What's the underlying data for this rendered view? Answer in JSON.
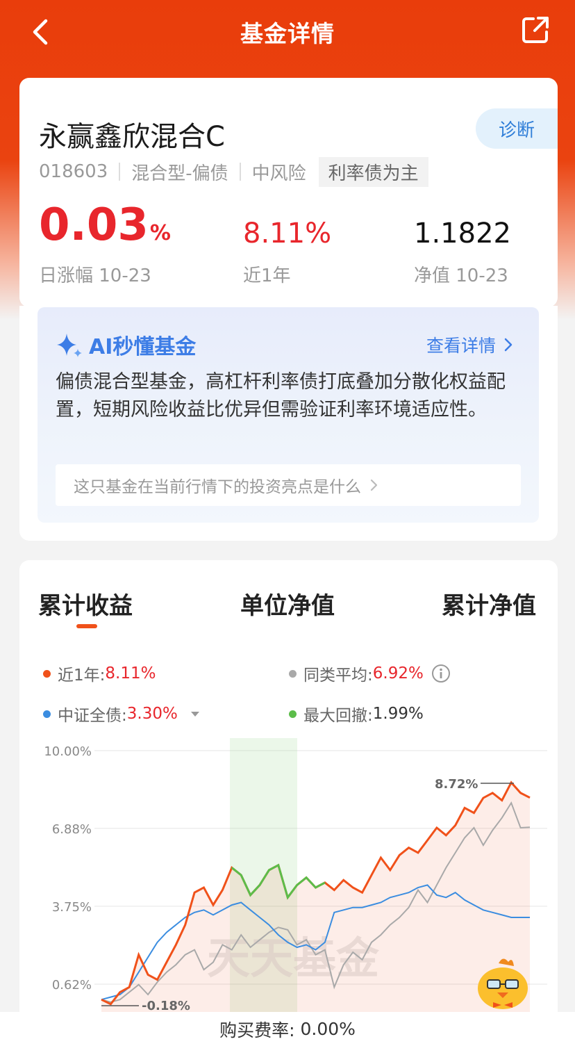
{
  "header": {
    "title": "基金详情"
  },
  "fund": {
    "name": "永赢鑫欣混合C",
    "diagnose_label": "诊断",
    "code": "018603",
    "type": "混合型-偏债",
    "risk": "中风险",
    "tag": "利率债为主",
    "daily_change": "0.03",
    "daily_change_unit": "%",
    "daily_change_label": "日涨幅 10-23",
    "year_return": "8.11%",
    "year_return_label": "近1年",
    "nav": "1.1822",
    "nav_label": "净值 10-23"
  },
  "ai": {
    "title": "AI秒懂基金",
    "more_label": "查看详情",
    "summary": "偏债混合型基金，高杠杆利率债打底叠加分散化权益配置，短期风险收益比优异但需验证利率环境适应性。",
    "question": "这只基金在当前行情下的投资亮点是什么"
  },
  "tabs": [
    {
      "label": "累计收益"
    },
    {
      "label": "单位净值"
    },
    {
      "label": "累计净值"
    }
  ],
  "legend": {
    "fund_label": "近1年:",
    "fund_value": "8.11%",
    "avg_label": "同类平均:",
    "avg_value": "6.92%",
    "index_label": "中证全债:",
    "index_value": "3.30%",
    "drawdown_label": "最大回撤:",
    "drawdown_value": "1.99%"
  },
  "colors": {
    "fund": "#f0511a",
    "average": "#a9a9a9",
    "index": "#3b8de0",
    "drawdown": "#5cbd4a"
  },
  "chart_data": {
    "type": "line",
    "yticks": [
      "10.00%",
      "6.88%",
      "3.75%",
      "0.62%"
    ],
    "ylim": [
      -0.5,
      10.0
    ],
    "watermark": "天天基金",
    "annotations": {
      "max": "8.72%",
      "min": "-0.18%"
    },
    "series": [
      {
        "name": "近1年",
        "values": [
          0.0,
          -0.18,
          0.3,
          0.5,
          1.8,
          1.0,
          0.8,
          1.5,
          2.2,
          3.0,
          4.3,
          4.5,
          3.8,
          4.4,
          5.3,
          5.0,
          4.2,
          4.6,
          5.2,
          5.4,
          4.1,
          4.6,
          4.9,
          4.5,
          4.7,
          4.4,
          4.8,
          4.5,
          4.3,
          5.0,
          5.7,
          5.2,
          5.8,
          6.1,
          5.9,
          6.4,
          6.9,
          6.6,
          7.0,
          7.7,
          7.5,
          8.1,
          8.3,
          8.0,
          8.72,
          8.3,
          8.11
        ]
      },
      {
        "name": "同类平均",
        "values": [
          0.0,
          -0.1,
          0.0,
          0.3,
          0.6,
          0.2,
          0.7,
          1.1,
          1.4,
          1.8,
          2.0,
          1.2,
          1.5,
          2.2,
          2.0,
          2.6,
          2.1,
          2.4,
          2.7,
          2.9,
          2.8,
          2.2,
          2.4,
          1.8,
          2.0,
          0.5,
          1.4,
          1.9,
          1.6,
          2.3,
          2.6,
          3.0,
          3.3,
          3.7,
          4.4,
          3.9,
          4.6,
          5.3,
          5.9,
          6.5,
          6.9,
          6.2,
          6.8,
          7.3,
          7.9,
          6.9,
          6.92
        ]
      },
      {
        "name": "中证全债",
        "values": [
          0.0,
          0.1,
          0.2,
          0.5,
          1.1,
          1.7,
          2.3,
          2.7,
          3.0,
          3.3,
          3.5,
          3.6,
          3.4,
          3.6,
          3.8,
          3.9,
          3.6,
          3.3,
          3.0,
          2.6,
          2.3,
          2.1,
          2.2,
          2.0,
          2.3,
          3.5,
          3.6,
          3.7,
          3.7,
          3.8,
          3.9,
          4.1,
          4.2,
          4.3,
          4.5,
          4.6,
          4.2,
          4.1,
          4.3,
          4.0,
          3.8,
          3.6,
          3.5,
          3.4,
          3.3,
          3.3,
          3.3
        ]
      }
    ]
  },
  "footer": {
    "fee_label": "购买费率:",
    "fee_value": "0.00%"
  }
}
